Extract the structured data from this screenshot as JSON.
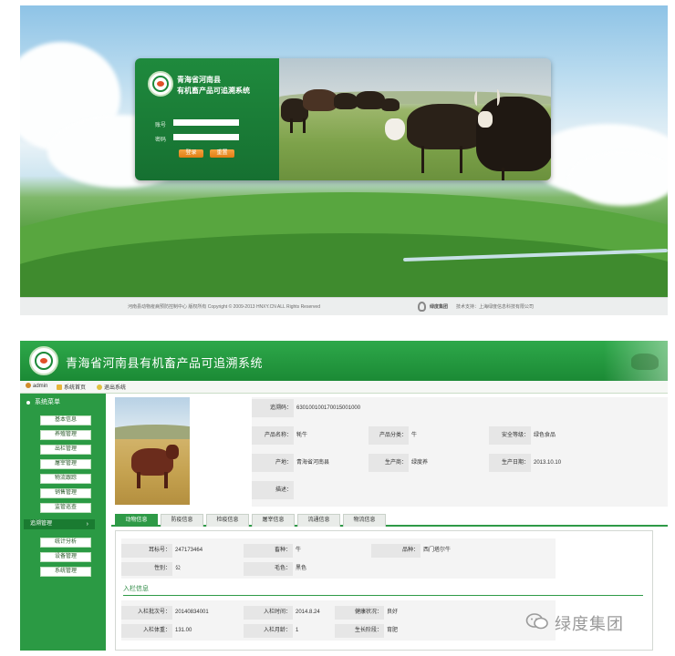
{
  "login": {
    "title_line1": "青海省河南县",
    "title_line2": "有机畜产品可追溯系统",
    "username_label": "账号",
    "password_label": "密码",
    "login_button": "登录",
    "reset_button": "重置",
    "footer_left": "河南县动物疫病预防控制中心  版权所有  Copyright © 2009-2013  HNXY.CN ALL Rights Reserved",
    "footer_right_brand": "绿度集团",
    "footer_right_text": "技术支持：上海绿度信息科技有限公司"
  },
  "admin": {
    "header_title": "青海省河南县有机畜产品可追溯系统",
    "toolbar": {
      "user": "admin",
      "home": "系统首页",
      "logout": "退出系统"
    },
    "sidebar": {
      "title": "系统菜单",
      "items": [
        "基本信息",
        "养殖管理",
        "出栏管理",
        "屠宰管理",
        "物流跟踪",
        "销售管理",
        "监管巡查",
        "追溯管理",
        "统计分析",
        "设备管理",
        "系统管理"
      ],
      "active_index": 7
    },
    "product": {
      "trace_code_label": "追溯码：",
      "trace_code": "630100100170015001000",
      "name_label": "产品名称：",
      "name": "牦牛",
      "category_label": "产品分类：",
      "category": "牛",
      "safety_label": "安全等级：",
      "safety": "绿色食品",
      "origin_label": "产地：",
      "origin": "青海省河南县",
      "producer_label": "生产商：",
      "producer": "绿度养",
      "prod_date_label": "生产日期：",
      "prod_date": "2013.10.10",
      "desc_label": "描述："
    },
    "tabs": [
      "动物信息",
      "防疫信息",
      "检疫信息",
      "屠宰信息",
      "流通信息",
      "物流信息"
    ],
    "active_tab": 0,
    "animal": {
      "ear_tag_label": "耳标号：",
      "ear_tag": "247173464",
      "species_label": "畜种：",
      "species": "牛",
      "breed_label": "品种：",
      "breed": "西门塔尔牛",
      "sex_label": "性别：",
      "sex": "公",
      "color_label": "毛色：",
      "color": "黑色"
    },
    "section_title": "入栏信息",
    "entry": {
      "entry_no_label": "入栏批次号：",
      "entry_no": "20140834001",
      "entry_time_label": "入栏时间：",
      "entry_time": "2014.8.24",
      "health_label": "健康状况：",
      "health": "良好",
      "entry_weight_label": "入栏体重：",
      "entry_weight": "131.00",
      "entry_age_label": "入栏月龄：",
      "entry_age": "1",
      "mgmt_label": "生长阶段：",
      "mgmt": "育肥"
    }
  },
  "watermark": {
    "text": "绿度集团"
  },
  "colors": {
    "brand_green": "#1b8a35",
    "accent_orange": "#e07d14"
  }
}
